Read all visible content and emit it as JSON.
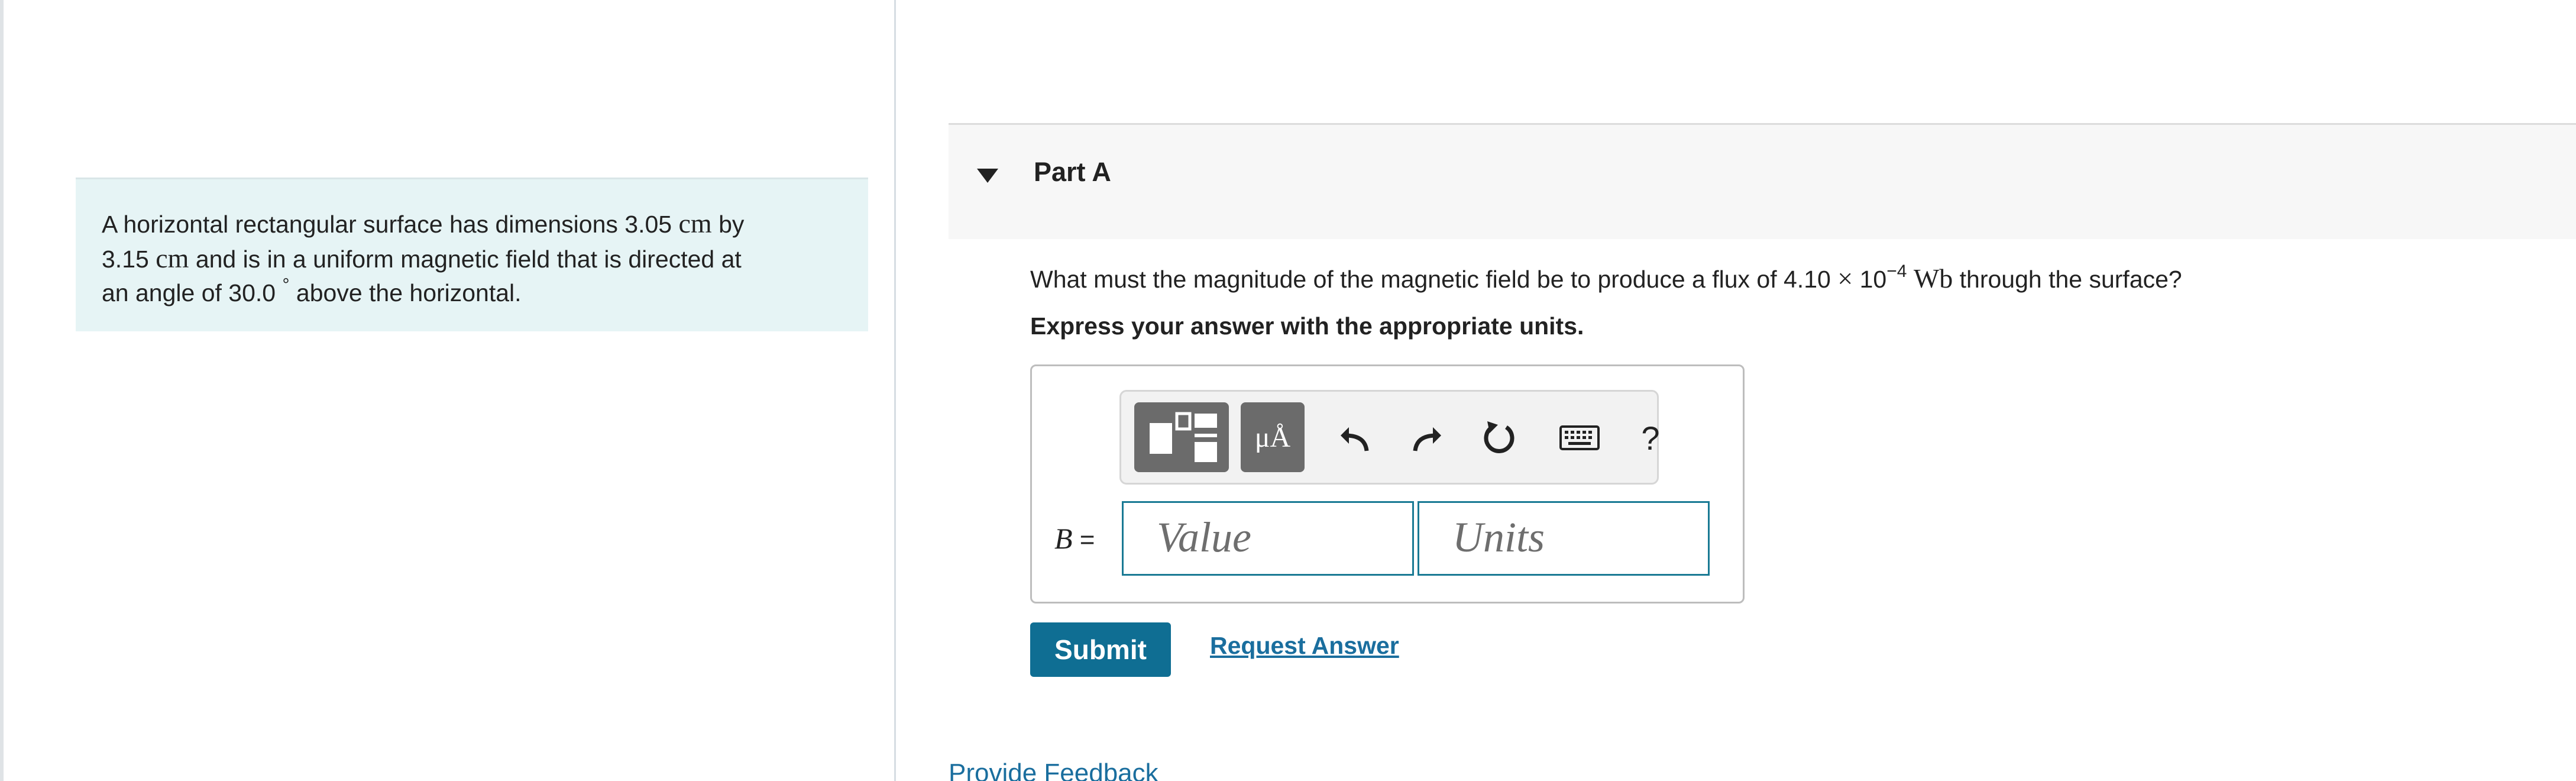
{
  "problem": {
    "text_1": "A horizontal rectangular surface has dimensions 3.05",
    "unit_1": "cm",
    "text_2": "by",
    "text_3": "3.15",
    "unit_2": "cm",
    "text_4": "and is in a uniform magnetic field that is directed at",
    "text_5": "an angle of 30.0",
    "degree": "°",
    "text_6": "above the horizontal."
  },
  "part": {
    "title": "Part A"
  },
  "question": {
    "text_before": "What must the magnitude of the magnetic field be to produce a flux of 4.10",
    "times": "×",
    "base": "10",
    "exponent": "−4",
    "unit": "Wb",
    "text_after": "through the surface?"
  },
  "instruction": "Express your answer with the appropriate units.",
  "answer": {
    "variable": "B",
    "equals": "=",
    "value_placeholder": "Value",
    "units_placeholder": "Units"
  },
  "toolbar": {
    "units_button_label": "μÅ",
    "help_label": "?",
    "icons": [
      "templates-icon",
      "units-icon",
      "undo-icon",
      "redo-icon",
      "reset-icon",
      "keyboard-icon",
      "help-icon"
    ]
  },
  "actions": {
    "submit_label": "Submit",
    "request_answer_label": "Request Answer",
    "feedback_label": "Provide Feedback"
  },
  "colors": {
    "problem_bg": "#e6f4f5",
    "accent": "#0f6e93",
    "link": "#1a6e9e",
    "input_border": "#1a7a94"
  }
}
